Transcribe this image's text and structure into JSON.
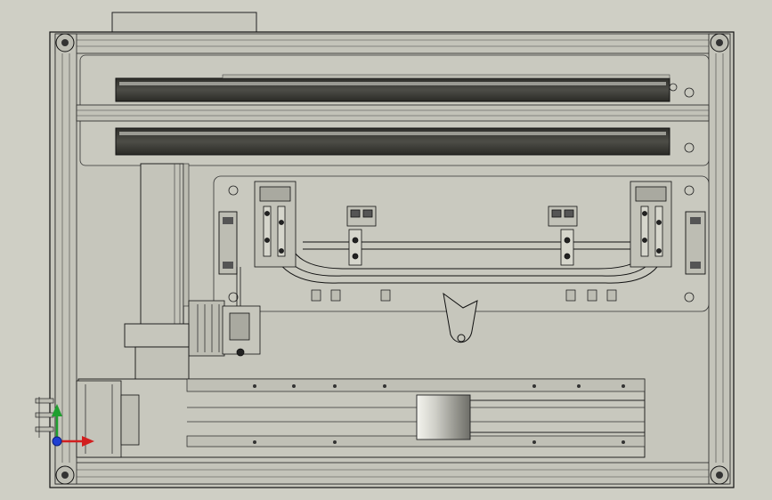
{
  "app": {
    "view": "cad-graphics-viewport",
    "background": "#cfcfc5",
    "linework": "#1a1a1a",
    "shaded_panel": "#4a4a44"
  },
  "triad": {
    "x_axis_color": "#d21f1f",
    "y_axis_color": "#1f9f2f",
    "z_axis_color": "#1f3fd2",
    "x_label": "",
    "y_label": "",
    "z_label": ""
  },
  "icons": {
    "fastener": "bolt-icon",
    "triad": "axis-triad-icon"
  }
}
